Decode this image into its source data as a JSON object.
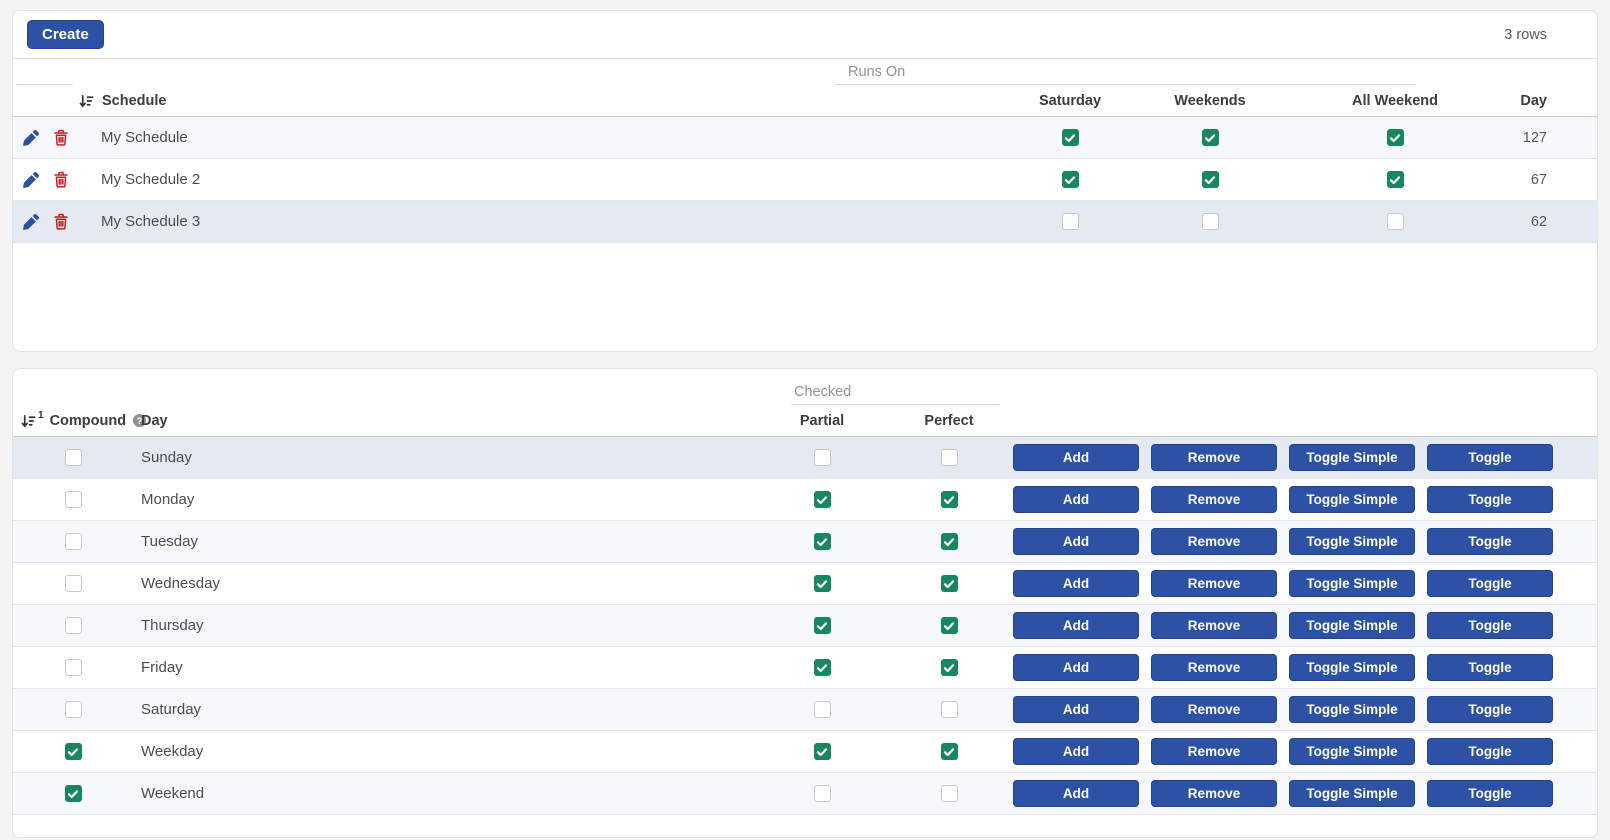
{
  "toolbar": {
    "create_label": "Create",
    "rows_count": "3 rows"
  },
  "schedules_table": {
    "group_header": "Runs On",
    "columns": {
      "schedule": "Schedule",
      "saturday": "Saturday",
      "weekends": "Weekends",
      "all_weekend": "All Weekend",
      "day": "Day"
    },
    "rows": [
      {
        "schedule": "My Schedule",
        "saturday": true,
        "weekends": true,
        "all_weekend": true,
        "day": "127",
        "striped": true,
        "selected": false
      },
      {
        "schedule": "My Schedule 2",
        "saturday": true,
        "weekends": true,
        "all_weekend": true,
        "day": "67",
        "striped": false,
        "selected": false
      },
      {
        "schedule": "My Schedule 3",
        "saturday": false,
        "weekends": false,
        "all_weekend": false,
        "day": "62",
        "striped": false,
        "selected": true
      }
    ]
  },
  "days_table": {
    "group_header": "Checked",
    "sort_order_badge": "1",
    "columns": {
      "compound": "Compound",
      "day": "Day",
      "partial": "Partial",
      "perfect": "Perfect"
    },
    "row_buttons": [
      "Add",
      "Remove",
      "Toggle Simple",
      "Toggle"
    ],
    "rows": [
      {
        "day": "Sunday",
        "compound": false,
        "partial": false,
        "perfect": false,
        "striped": false,
        "selected": true
      },
      {
        "day": "Monday",
        "compound": false,
        "partial": true,
        "perfect": true,
        "striped": false,
        "selected": false
      },
      {
        "day": "Tuesday",
        "compound": false,
        "partial": true,
        "perfect": true,
        "striped": true,
        "selected": false
      },
      {
        "day": "Wednesday",
        "compound": false,
        "partial": true,
        "perfect": true,
        "striped": false,
        "selected": false
      },
      {
        "day": "Thursday",
        "compound": false,
        "partial": true,
        "perfect": true,
        "striped": true,
        "selected": false
      },
      {
        "day": "Friday",
        "compound": false,
        "partial": true,
        "perfect": true,
        "striped": false,
        "selected": false
      },
      {
        "day": "Saturday",
        "compound": false,
        "partial": false,
        "perfect": false,
        "striped": true,
        "selected": false
      },
      {
        "day": "Weekday",
        "compound": true,
        "partial": true,
        "perfect": true,
        "striped": false,
        "selected": false
      },
      {
        "day": "Weekend",
        "compound": true,
        "partial": false,
        "perfect": false,
        "striped": true,
        "selected": false
      }
    ]
  },
  "colors": {
    "accent_blue": "#2d51a5",
    "checkbox_green": "#18875f",
    "delete_red": "#c02222",
    "selected_row": "#e4e9f2",
    "striped_row": "#f6f8fc"
  }
}
